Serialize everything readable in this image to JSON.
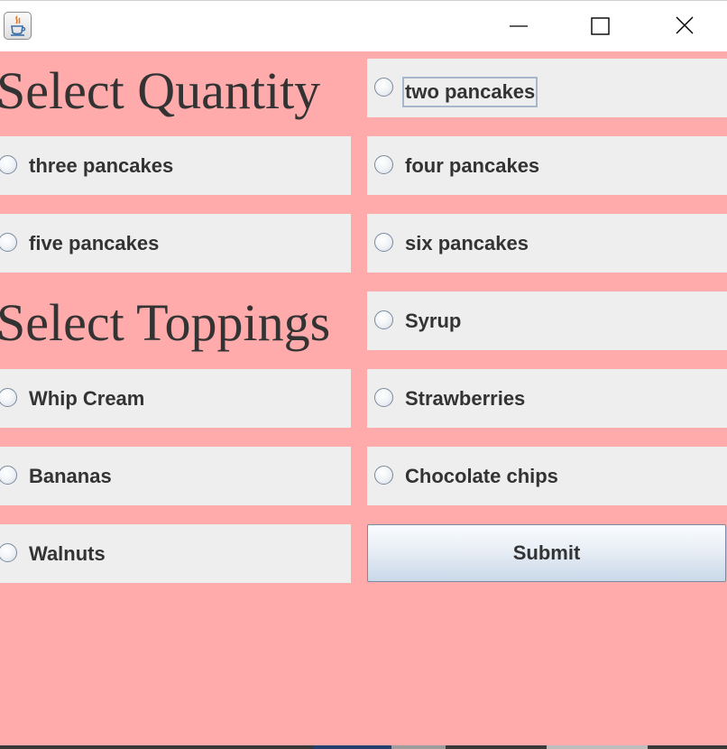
{
  "window": {
    "app_icon": "java-cup-icon",
    "controls": {
      "minimize": "minimize-icon",
      "maximize": "maximize-icon",
      "close": "close-icon"
    }
  },
  "colors": {
    "panel_background": "#ffabab",
    "cell_background": "#eeeeee",
    "text": "#333333"
  },
  "quantity": {
    "heading": "Select Quantity",
    "options": [
      "two pancakes",
      "three pancakes",
      "four pancakes",
      "five pancakes",
      "six pancakes"
    ],
    "focused_option": "two pancakes"
  },
  "toppings": {
    "heading": "Select Toppings",
    "options": [
      "Syrup",
      "Whip Cream",
      "Strawberries",
      "Bananas",
      "Chocolate chips",
      "Walnuts"
    ]
  },
  "submit_label": "Submit"
}
